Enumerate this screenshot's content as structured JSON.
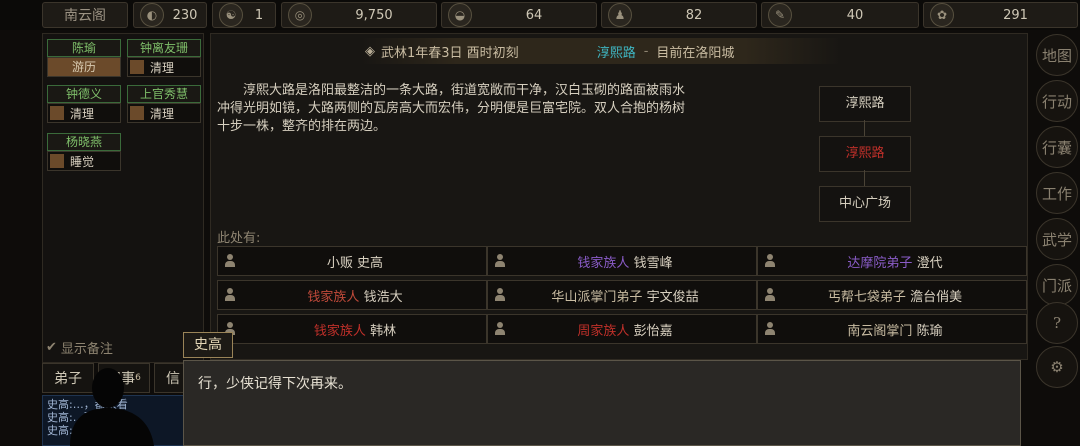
{
  "topbar": {
    "name": "南云阁",
    "stats": [
      {
        "icon": "compass-icon",
        "glyph": "◐",
        "value": "230"
      },
      {
        "icon": "yinyang-icon",
        "glyph": "☯",
        "value": "1"
      },
      {
        "icon": "coin-icon",
        "glyph": "◎",
        "value": "9,750"
      },
      {
        "icon": "food-icon",
        "glyph": "◒",
        "value": "64"
      },
      {
        "icon": "figure-icon",
        "glyph": "♟",
        "value": "82"
      },
      {
        "icon": "brush-icon",
        "glyph": "✎",
        "value": "40"
      },
      {
        "icon": "beast-icon",
        "glyph": "✿",
        "value": "291"
      }
    ]
  },
  "party": [
    {
      "name": "陈瑜",
      "action": "游历"
    },
    {
      "name": "钟离友珊",
      "action": "清理"
    },
    {
      "name": "钟德义",
      "action": "清理"
    },
    {
      "name": "上官秀慧",
      "action": "清理"
    },
    {
      "name": "杨晓燕",
      "action": "睡觉"
    }
  ],
  "header": {
    "date": "武林1年春3日 酉时初刻",
    "location": "淳熙路",
    "separator": "-",
    "city_note": "目前在洛阳城"
  },
  "description": "淳熙大路是洛阳最整洁的一条大路，街道宽敞而干净，汉白玉砌的路面被雨水冲得光明如镜，大路两侧的瓦房高大而宏伟，分明便是巨富宅院。双人合抱的杨树十步一株，整齐的排在两边。",
  "map": {
    "north": "淳熙路",
    "current": "淳熙路",
    "south": "中心广场"
  },
  "here_label": "此处有:",
  "npcs": [
    {
      "tag": "",
      "name": "小贩 史高",
      "tag_color": ""
    },
    {
      "tag": "钱家族人",
      "name": "钱雪峰",
      "tag_color": "#8a5cc8"
    },
    {
      "tag": "达摩院弟子",
      "name": "澄代",
      "tag_color": "#8a5cc8"
    },
    {
      "tag": "钱家族人",
      "name": "钱浩大",
      "tag_color": "#c04a3a"
    },
    {
      "tag": "华山派掌门弟子",
      "name": "宇文俊喆",
      "tag_color": "#c9bca2"
    },
    {
      "tag": "丐帮七袋弟子",
      "name": "澹台俏美",
      "tag_color": "#c9bca2"
    },
    {
      "tag": "钱家族人",
      "name": "韩林",
      "tag_color": "#c0302a"
    },
    {
      "tag": "周家族人",
      "name": "彭怡嘉",
      "tag_color": "#c0302a"
    },
    {
      "tag": "南云阁掌门",
      "name": "陈瑜",
      "tag_color": "#c9bca2"
    }
  ],
  "sidebar": [
    {
      "label": "地图"
    },
    {
      "label": "行动"
    },
    {
      "label": "行囊"
    },
    {
      "label": "工作"
    },
    {
      "label": "武学"
    },
    {
      "label": "门派"
    },
    {
      "label": "?"
    },
    {
      "label": "⚙"
    }
  ],
  "bottom": {
    "show_remark": "显示备注",
    "tabs": [
      "弟子",
      "记事",
      "信"
    ],
    "tab_badge": "6",
    "chat": [
      "史高:…，都来看",
      "史高:…要不要",
      "史高:…"
    ],
    "speaker": "史高",
    "dialog": "行，少侠记得下次再来。"
  }
}
